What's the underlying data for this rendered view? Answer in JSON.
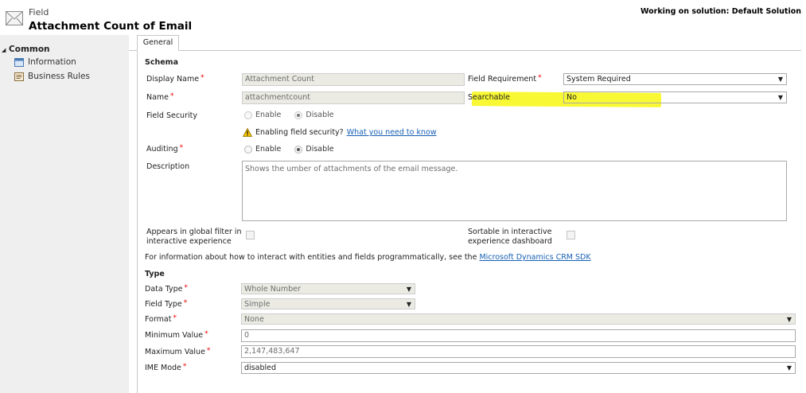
{
  "header": {
    "entity_type": "Field",
    "title": "Attachment Count of Email",
    "solution_text": "Working on solution: Default Solution"
  },
  "sidebar": {
    "group_label": "Common",
    "items": [
      {
        "label": "Information",
        "icon": "form-icon"
      },
      {
        "label": "Business Rules",
        "icon": "business-rules-icon"
      }
    ]
  },
  "tabs": [
    {
      "label": "General"
    }
  ],
  "schema": {
    "heading": "Schema",
    "display_name": {
      "label": "Display Name",
      "value": "Attachment Count"
    },
    "name": {
      "label": "Name",
      "value": "attachmentcount"
    },
    "field_requirement": {
      "label": "Field Requirement",
      "value": "System Required"
    },
    "searchable": {
      "label": "Searchable",
      "value": "No"
    },
    "field_security": {
      "label": "Field Security",
      "options": [
        "Enable",
        "Disable"
      ],
      "selected": "Disable",
      "warning_text": "Enabling field security?",
      "warning_link": "What you need to know"
    },
    "auditing": {
      "label": "Auditing",
      "options": [
        "Enable",
        "Disable"
      ],
      "selected": "Disable"
    },
    "description": {
      "label": "Description",
      "value": "Shows the umber of attachments of the email message."
    },
    "global_filter": {
      "label_line1": "Appears in global filter in",
      "label_line2": "interactive experience"
    },
    "sortable": {
      "label_line1": "Sortable in interactive",
      "label_line2": "experience dashboard"
    },
    "info_text": "For information about how to interact with entities and fields programmatically, see the",
    "info_link": "Microsoft Dynamics CRM SDK"
  },
  "type_section": {
    "heading": "Type",
    "data_type": {
      "label": "Data Type",
      "value": "Whole Number"
    },
    "field_type": {
      "label": "Field Type",
      "value": "Simple"
    },
    "format": {
      "label": "Format",
      "value": "None"
    },
    "min_value": {
      "label": "Minimum Value",
      "value": "0"
    },
    "max_value": {
      "label": "Maximum Value",
      "value": "2,147,483,647"
    },
    "ime_mode": {
      "label": "IME Mode",
      "value": "disabled"
    }
  },
  "colors": {
    "highlight": "#f8f834",
    "link": "#1760b5",
    "required": "#e00000",
    "sidebar_bg": "#efefef"
  }
}
